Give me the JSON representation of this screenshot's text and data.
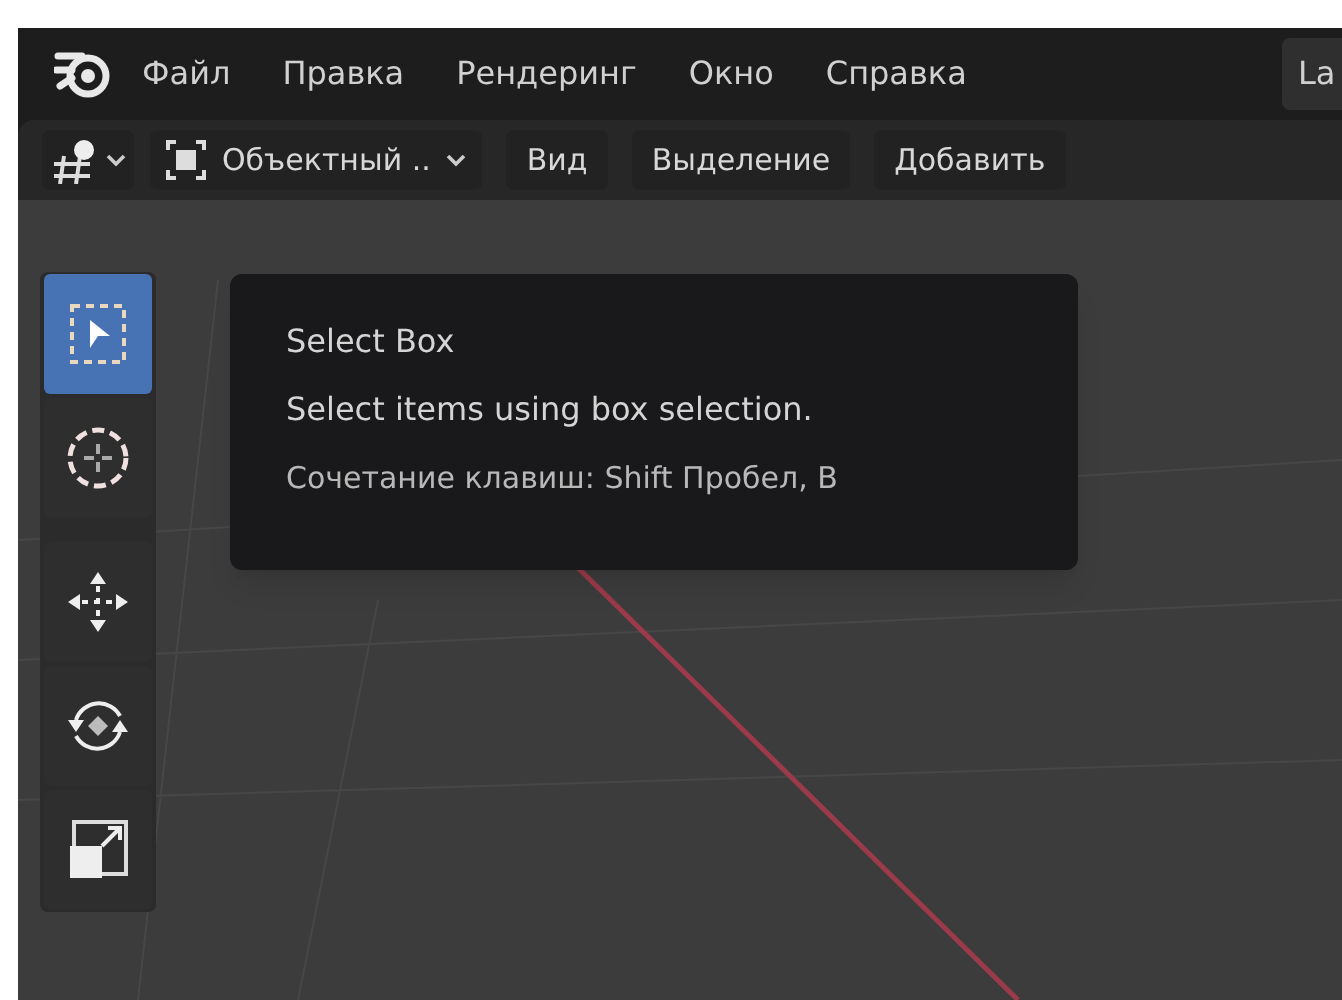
{
  "menu_bar": {
    "items": [
      "Файл",
      "Правка",
      "Рендеринг",
      "Окно",
      "Справка"
    ],
    "workspace_tab": "La"
  },
  "header": {
    "mode_dropdown": "Объектный ..",
    "menus": [
      "Вид",
      "Выделение",
      "Добавить"
    ]
  },
  "toolbar": {
    "tools": [
      {
        "kind": "select_box",
        "selected": true
      },
      {
        "kind": "cursor",
        "selected": false
      },
      {
        "kind": "move",
        "selected": false
      },
      {
        "kind": "rotate",
        "selected": false
      },
      {
        "kind": "scale",
        "selected": false
      }
    ]
  },
  "tooltip": {
    "title": "Select Box",
    "description": "Select items using box selection.",
    "shortcut": "Сочетание клавиш: Shift Пробел, B"
  }
}
